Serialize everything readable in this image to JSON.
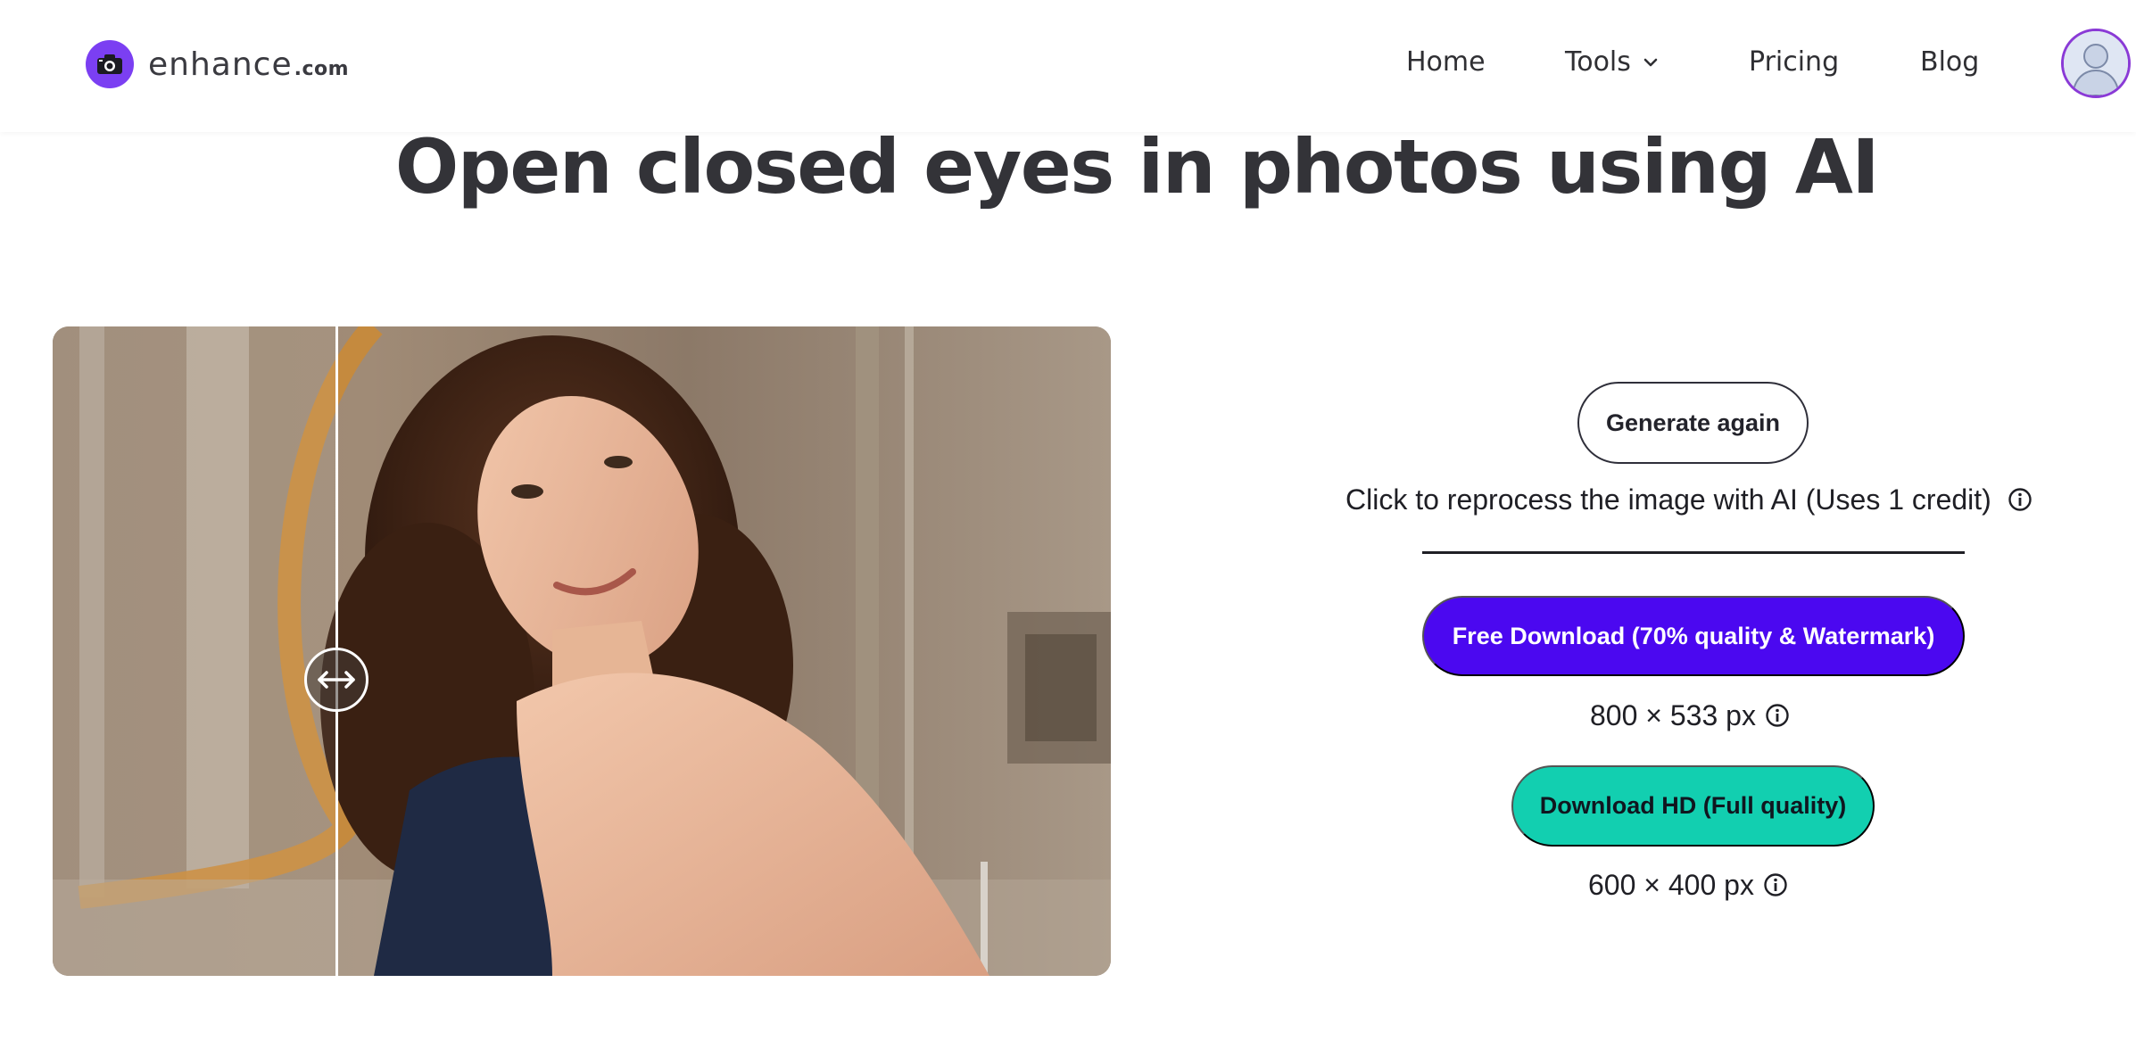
{
  "header": {
    "logo": {
      "name": "enhance",
      "tld": ".com",
      "icon": "camera-icon",
      "brand_color": "#7b3ff2"
    },
    "nav": [
      {
        "label": "Home"
      },
      {
        "label": "Tools",
        "icon": "chevron-down-icon"
      },
      {
        "label": "Pricing"
      },
      {
        "label": "Blog"
      }
    ],
    "avatar_icon": "user-avatar-icon"
  },
  "main": {
    "title": "Open closed eyes in photos using AI",
    "image_compare": {
      "handle_icon": "left-right-arrow-icon"
    },
    "actions": {
      "generate_again_label": "Generate again",
      "reprocess_note": "Click to reprocess the image with AI (Uses 1 credit)",
      "free_download_label": "Free Download (70% quality & Watermark)",
      "free_download_color": "#4b08f0",
      "free_size": "800 × 533 px",
      "hd_download_label": "Download HD (Full quality)",
      "hd_download_color": "#12cfb0",
      "hd_size": "600 × 400 px",
      "info_icon": "info-icon"
    }
  }
}
